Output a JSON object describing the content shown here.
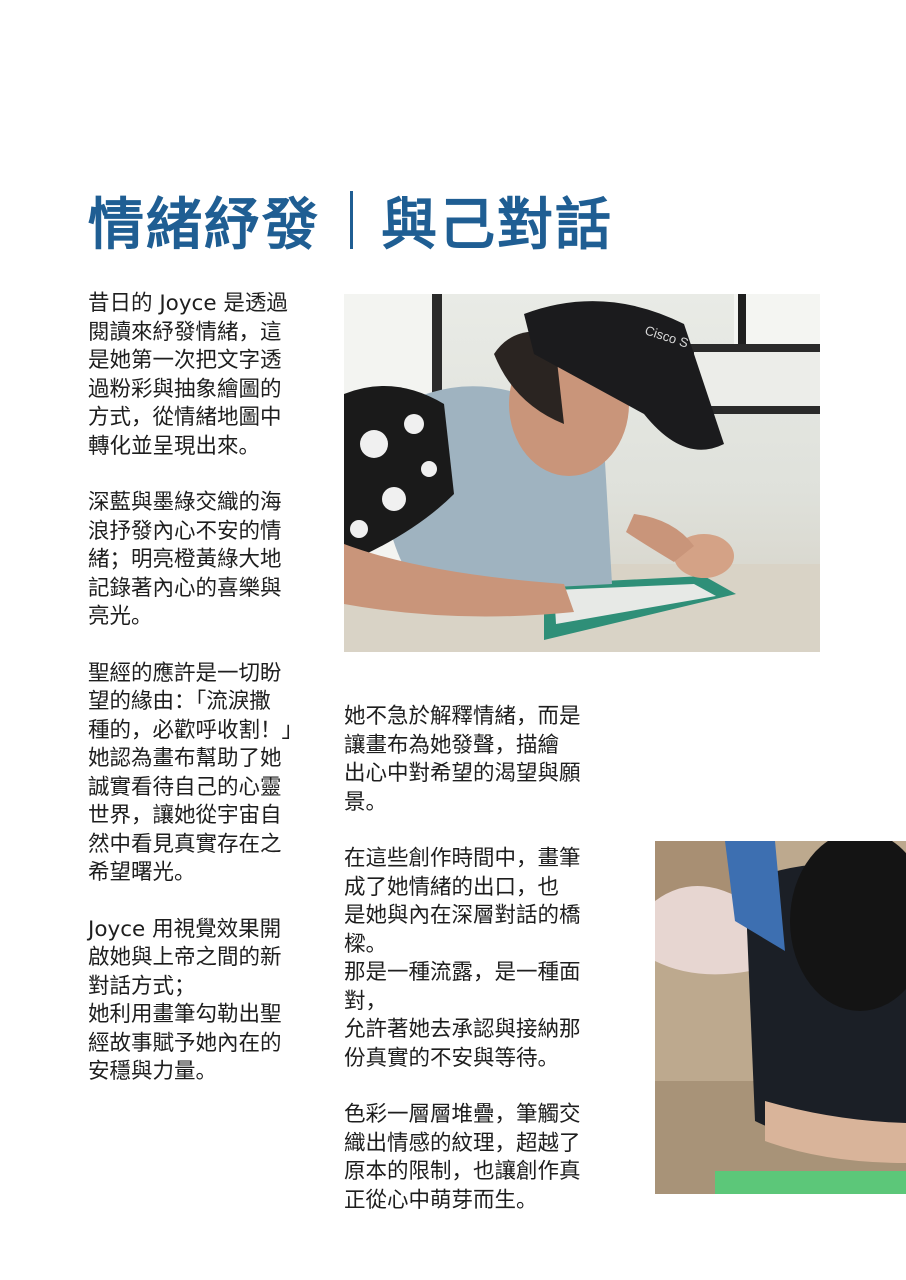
{
  "title": {
    "left": "情緒紓發",
    "right": "與己對話"
  },
  "left_column": {
    "paragraphs": [
      "昔日的 Joyce 是透過\n閱讀來紓發情緒，這\n是她第一次把文字透\n過粉彩與抽象繪圖的\n方式，從情緒地圖中\n轉化並呈現出來。",
      "深藍與墨綠交織的海\n浪抒發內心不安的情\n緒；明亮橙黃綠大地\n記錄著內心的喜樂與\n亮光。",
      "聖經的應許是一切盼\n望的緣由：「流淚撒\n種的，必歡呼收割！」\n她認為畫布幫助了她\n誠實看待自己的心靈\n世界，讓她從宇宙自\n然中看見真實存在之\n希望曙光。",
      "Joyce 用視覺效果開\n啟她與上帝之間的新\n對話方式；\n她利用畫筆勾勒出聖\n經故事賦予她內在的\n安穩與力量。"
    ]
  },
  "middle_column": {
    "paragraphs": [
      "她不急於解釋情緒，而是\n讓畫布為她發聲，描繪\n出心中對希望的渴望與願\n景。",
      "在這些創作時間中，畫筆\n成了她情緒的出口，也\n是她與內在深層對話的橋\n樑。\n那是一種流露，是一種面\n對，\n允許著她去承認與接納那\n份真實的不安與等待。",
      "色彩一層層堆疊，筆觸交\n織出情感的紋理，超越了\n原本的限制，也讓創作真\n正從心中萌芽而生。"
    ]
  },
  "photos": {
    "top_cap_text": "Cisco S"
  },
  "colors": {
    "title": "#1f5e93",
    "body_text": "#1e1e1e"
  }
}
